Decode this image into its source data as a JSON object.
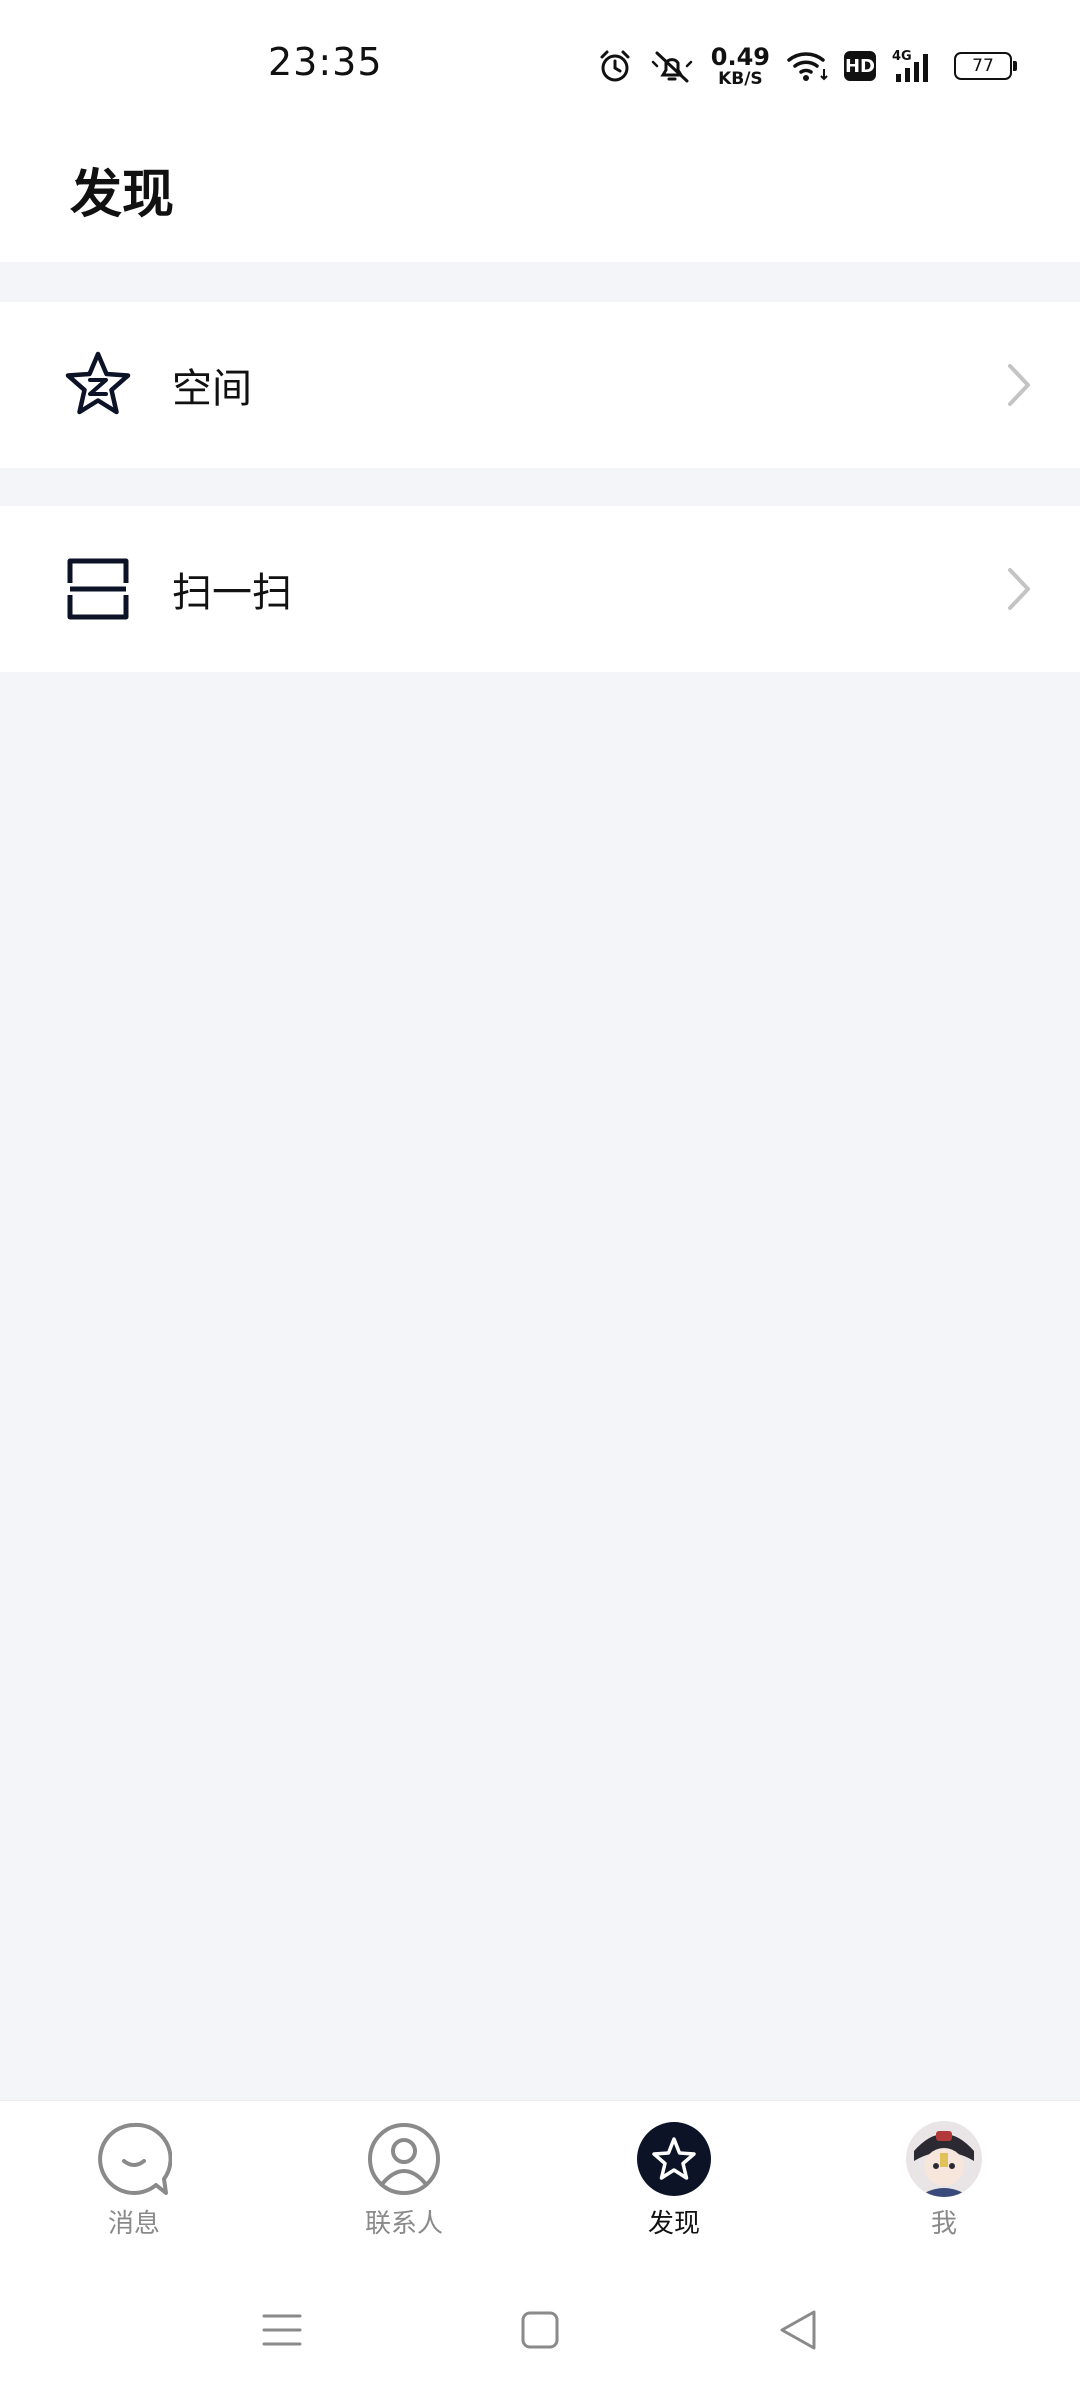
{
  "status": {
    "time": "23:35",
    "net_speed_value": "0.49",
    "net_speed_unit": "KB/S",
    "hd": "HD",
    "network": "4G",
    "battery": "77",
    "icons": [
      "alarm-icon",
      "mute-icon",
      "wifi-icon",
      "signal-icon",
      "battery-icon"
    ]
  },
  "header": {
    "title": "发现"
  },
  "menu": {
    "items": [
      {
        "label": "空间",
        "icon": "qzone-star-icon"
      },
      {
        "label": "扫一扫",
        "icon": "scan-icon"
      }
    ]
  },
  "nav": {
    "items": [
      {
        "label": "消息",
        "icon": "chat-bubble-icon",
        "active": false
      },
      {
        "label": "联系人",
        "icon": "contact-icon",
        "active": false
      },
      {
        "label": "发现",
        "icon": "star-icon",
        "active": true
      },
      {
        "label": "我",
        "icon": "avatar",
        "active": false
      }
    ]
  },
  "colors": {
    "background": "#f4f5f9",
    "surface": "#ffffff",
    "active_nav": "#0c1326",
    "inactive": "#8a8a8a"
  }
}
